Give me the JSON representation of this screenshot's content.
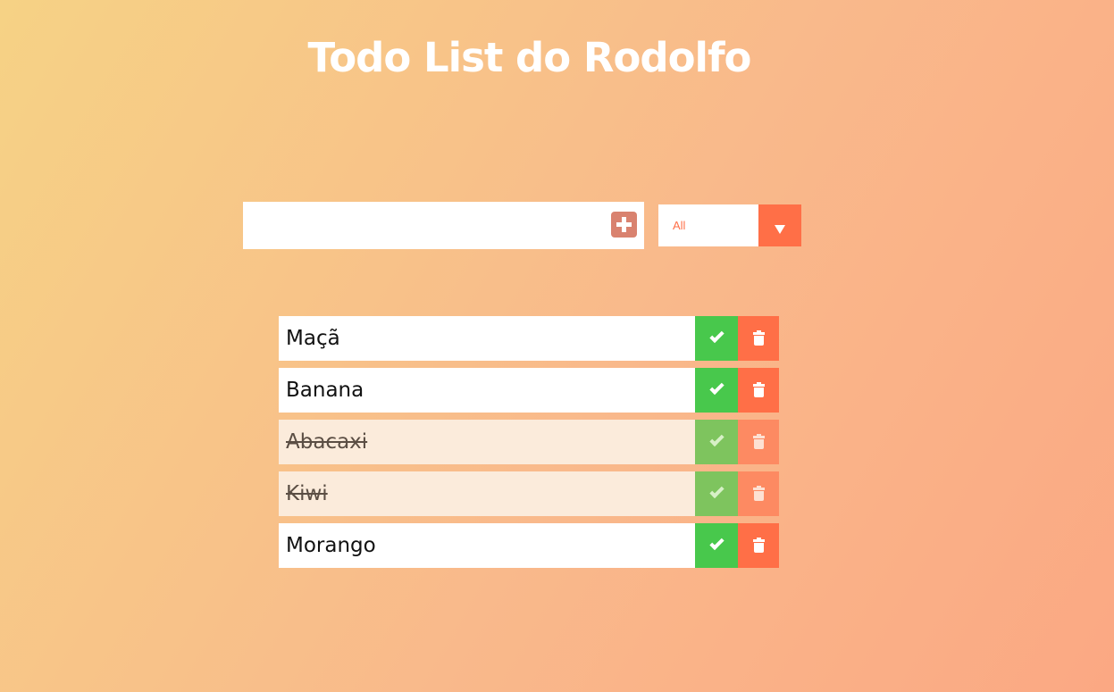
{
  "header": {
    "title": "Todo List do Rodolfo"
  },
  "form": {
    "input_value": "",
    "add_icon": "plus-square-icon"
  },
  "filter": {
    "selected": "All",
    "arrow_icon": "caret-down-icon"
  },
  "todos": [
    {
      "text": "Maçã",
      "completed": false
    },
    {
      "text": "Banana",
      "completed": false
    },
    {
      "text": "Abacaxi",
      "completed": true
    },
    {
      "text": "Kiwi",
      "completed": true
    },
    {
      "text": "Morango",
      "completed": false
    }
  ],
  "colors": {
    "accent": "#ff6f47",
    "complete": "#48c84c",
    "add_button": "#d9826f",
    "completed_row": "#fbebdb"
  }
}
